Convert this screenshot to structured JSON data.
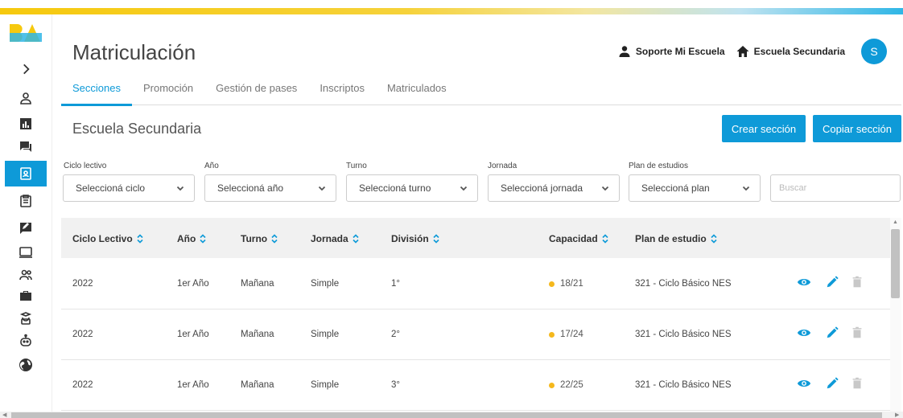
{
  "header": {
    "title": "Matriculación",
    "support_label": "Soporte Mi Escuela",
    "school_label": "Escuela Secundaria",
    "avatar_initial": "S"
  },
  "sidebar": {
    "logo": "BA",
    "items": [
      {
        "icon": "chevron-right-icon"
      },
      {
        "icon": "user-icon"
      },
      {
        "icon": "bar-chart-icon"
      },
      {
        "icon": "chat-icon"
      },
      {
        "icon": "id-badge-icon",
        "active": true
      },
      {
        "icon": "clipboard-icon"
      },
      {
        "icon": "message-edit-icon"
      },
      {
        "icon": "monitor-icon"
      },
      {
        "icon": "users-icon"
      },
      {
        "icon": "briefcase-icon"
      },
      {
        "icon": "student-icon"
      },
      {
        "icon": "robot-icon"
      },
      {
        "icon": "globe-icon"
      }
    ]
  },
  "tabs": [
    "Secciones",
    "Promoción",
    "Gestión de pases",
    "Inscriptos",
    "Matriculados"
  ],
  "active_tab": "Secciones",
  "section_title": "Escuela Secundaria",
  "buttons": {
    "create": "Crear sección",
    "copy": "Copiar sección"
  },
  "filters": [
    {
      "label": "Ciclo lectivo",
      "value": "Seleccioná ciclo"
    },
    {
      "label": "Año",
      "value": "Seleccioná año"
    },
    {
      "label": "Turno",
      "value": "Seleccioná turno"
    },
    {
      "label": "Jornada",
      "value": "Seleccioná jornada"
    },
    {
      "label": "Plan de estudios",
      "value": "Seleccioná plan"
    }
  ],
  "search": {
    "placeholder": "Buscar"
  },
  "table": {
    "columns": [
      "Ciclo Lectivo",
      "Año",
      "Turno",
      "Jornada",
      "División",
      "Capacidad",
      "Plan de estudio"
    ],
    "rows": [
      {
        "ciclo": "2022",
        "anio": "1er Año",
        "turno": "Mañana",
        "jornada": "Simple",
        "division": "1°",
        "capacidad": "18/21",
        "plan": "321 - Ciclo Básico NES"
      },
      {
        "ciclo": "2022",
        "anio": "1er Año",
        "turno": "Mañana",
        "jornada": "Simple",
        "division": "2°",
        "capacidad": "17/24",
        "plan": "321 - Ciclo Básico NES"
      },
      {
        "ciclo": "2022",
        "anio": "1er Año",
        "turno": "Mañana",
        "jornada": "Simple",
        "division": "3°",
        "capacidad": "22/25",
        "plan": "321 - Ciclo Básico NES"
      }
    ]
  },
  "colors": {
    "accent": "#0e9ad8",
    "capacity_dot": "#f5b81c",
    "delete_disabled": "#c8c8c8"
  }
}
